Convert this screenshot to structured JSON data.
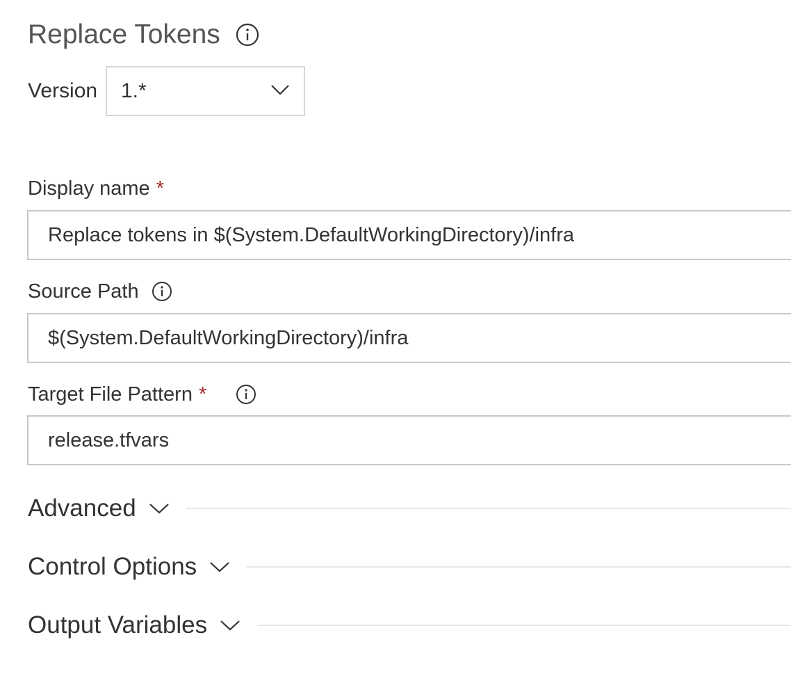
{
  "task": {
    "title": "Replace Tokens"
  },
  "version": {
    "label": "Version",
    "selected": "1.*"
  },
  "fields": {
    "display_name": {
      "label": "Display name",
      "required_mark": "*",
      "value": "Replace tokens in $(System.DefaultWorkingDirectory)/infra"
    },
    "source_path": {
      "label": "Source Path",
      "value": "$(System.DefaultWorkingDirectory)/infra"
    },
    "target_file_pattern": {
      "label": "Target File Pattern",
      "required_mark": "*",
      "value": "release.tfvars"
    }
  },
  "sections": {
    "advanced": "Advanced",
    "control_options": "Control Options",
    "output_variables": "Output Variables"
  },
  "icons": {
    "info": "info-icon",
    "chevron": "chevron-down-icon"
  },
  "colors": {
    "required": "#a4262c",
    "title": "#555555",
    "border": "#c8c8c8"
  }
}
